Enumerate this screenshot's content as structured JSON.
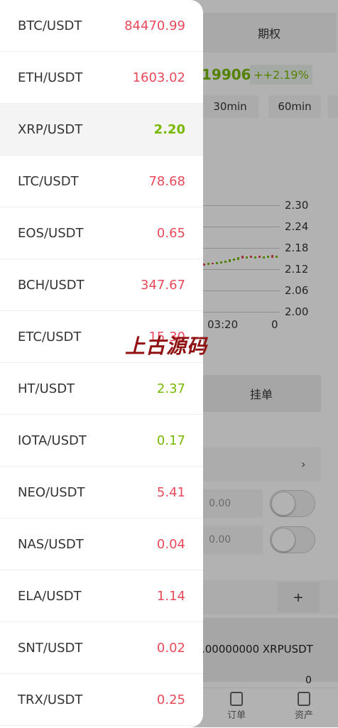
{
  "background": {
    "tab_label": "期权",
    "current_price": "19906",
    "change_pct": "++2.19%",
    "periods": [
      "30min",
      "60min"
    ],
    "y_ticks": [
      "2.30",
      "2.24",
      "2.18",
      "2.12",
      "2.06",
      "2.00"
    ],
    "x_ticks": [
      "03:20",
      "0"
    ],
    "order_button": "挂单",
    "chevron": "›",
    "input_values": [
      "0.00",
      "0.00"
    ],
    "plus_label": "+",
    "amount_text": ".00000000 XRPUSDT",
    "zero_value": "0",
    "nav": [
      {
        "label": "订单",
        "icon": "orders-icon"
      },
      {
        "label": "资产",
        "icon": "wallet-icon"
      }
    ]
  },
  "watermark": "上古源码",
  "colors": {
    "up": "#78b900",
    "down": "#e9495a"
  },
  "pairs": [
    {
      "name": "BTC/USDT",
      "price": "84470.99",
      "dir": "down"
    },
    {
      "name": "ETH/USDT",
      "price": "1603.02",
      "dir": "down"
    },
    {
      "name": "XRP/USDT",
      "price": "2.20",
      "dir": "up"
    },
    {
      "name": "LTC/USDT",
      "price": "78.68",
      "dir": "down"
    },
    {
      "name": "EOS/USDT",
      "price": "0.65",
      "dir": "down"
    },
    {
      "name": "BCH/USDT",
      "price": "347.67",
      "dir": "down"
    },
    {
      "name": "ETC/USDT",
      "price": "15.30",
      "dir": "down"
    },
    {
      "name": "HT/USDT",
      "price": "2.37",
      "dir": "up"
    },
    {
      "name": "IOTA/USDT",
      "price": "0.17",
      "dir": "up"
    },
    {
      "name": "NEO/USDT",
      "price": "5.41",
      "dir": "down"
    },
    {
      "name": "NAS/USDT",
      "price": "0.04",
      "dir": "down"
    },
    {
      "name": "ELA/USDT",
      "price": "1.14",
      "dir": "down"
    },
    {
      "name": "SNT/USDT",
      "price": "0.02",
      "dir": "down"
    },
    {
      "name": "TRX/USDT",
      "price": "0.25",
      "dir": "down"
    }
  ],
  "selected_pair": "XRP/USDT"
}
